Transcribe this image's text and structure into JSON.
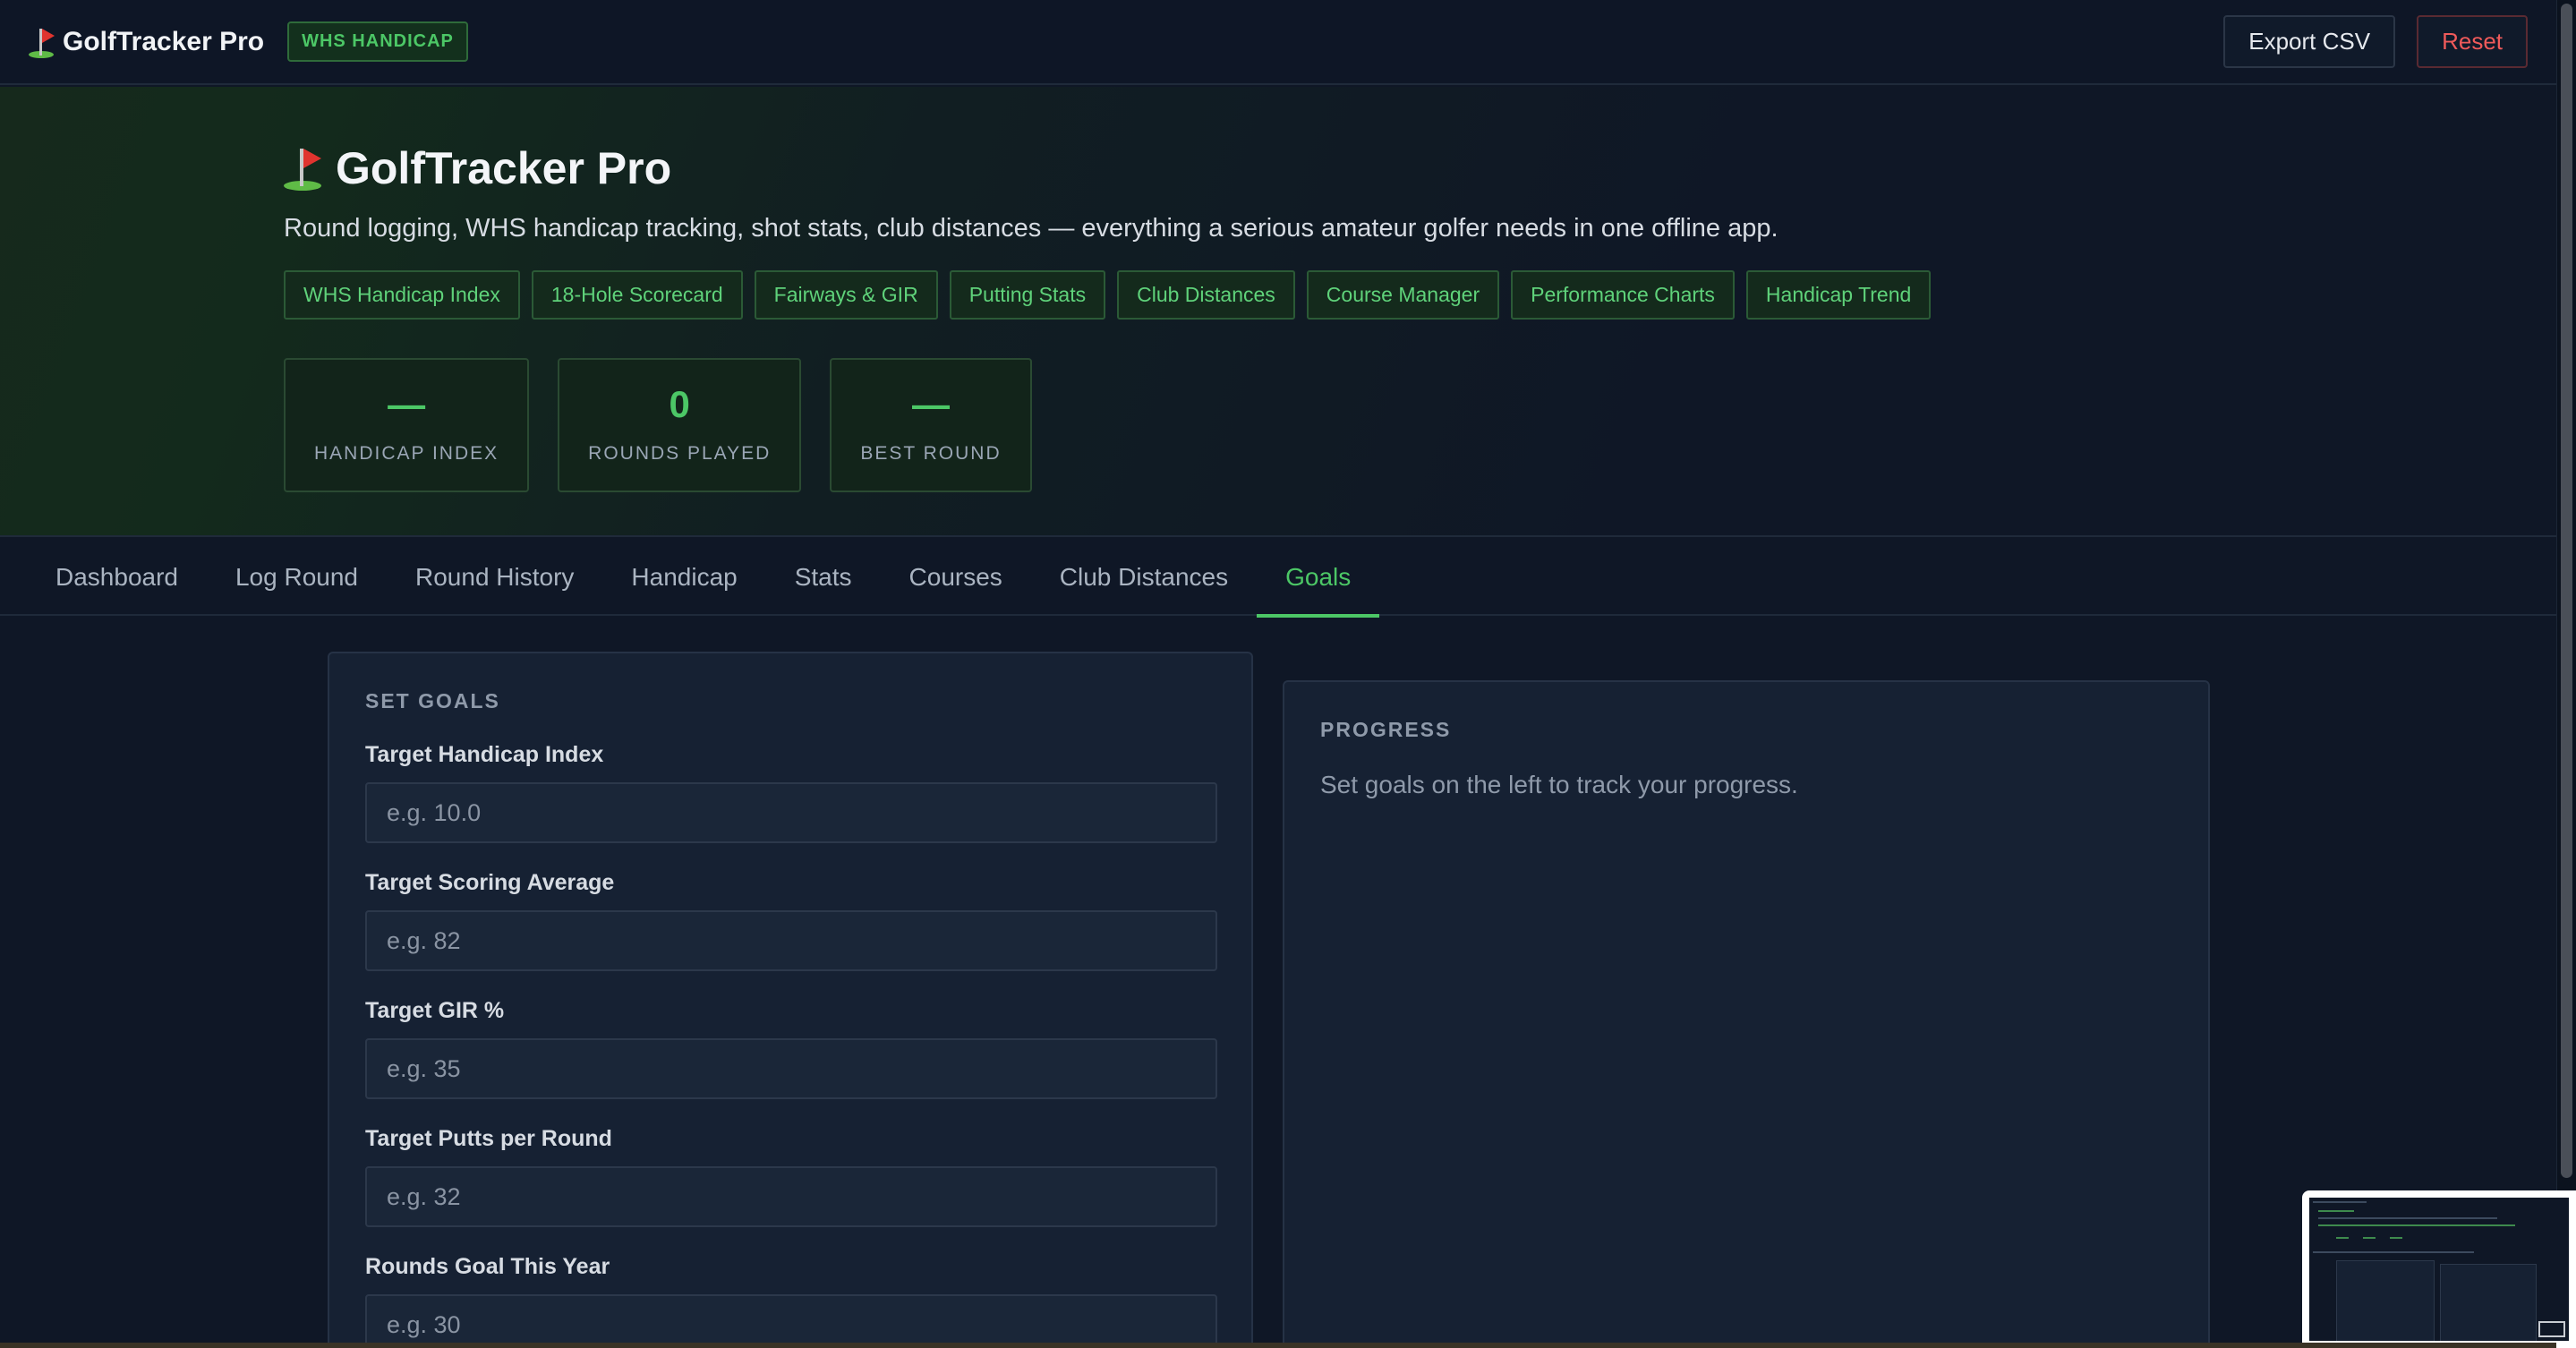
{
  "topbar": {
    "brand": "GolfTracker Pro",
    "badge": "WHS HANDICAP",
    "export_label": "Export CSV",
    "reset_label": "Reset"
  },
  "hero": {
    "title": "GolfTracker Pro",
    "subtitle": "Round logging, WHS handicap tracking, shot stats, club distances — everything a serious amateur golfer needs in one offline app.",
    "chips": [
      "WHS Handicap Index",
      "18-Hole Scorecard",
      "Fairways & GIR",
      "Putting Stats",
      "Club Distances",
      "Course Manager",
      "Performance Charts",
      "Handicap Trend"
    ],
    "stats": [
      {
        "value": "—",
        "label": "HANDICAP INDEX"
      },
      {
        "value": "0",
        "label": "ROUNDS PLAYED"
      },
      {
        "value": "—",
        "label": "BEST ROUND"
      }
    ]
  },
  "tabs": [
    "Dashboard",
    "Log Round",
    "Round History",
    "Handicap",
    "Stats",
    "Courses",
    "Club Distances",
    "Goals"
  ],
  "active_tab": "Goals",
  "goals": {
    "heading": "SET GOALS",
    "fields": [
      {
        "label": "Target Handicap Index",
        "placeholder": "e.g. 10.0",
        "value": ""
      },
      {
        "label": "Target Scoring Average",
        "placeholder": "e.g. 82",
        "value": ""
      },
      {
        "label": "Target GIR %",
        "placeholder": "e.g. 35",
        "value": ""
      },
      {
        "label": "Target Putts per Round",
        "placeholder": "e.g. 32",
        "value": ""
      },
      {
        "label": "Rounds Goal This Year",
        "placeholder": "e.g. 30",
        "value": ""
      }
    ]
  },
  "progress": {
    "heading": "PROGRESS",
    "message": "Set goals on the left to track your progress."
  },
  "colors": {
    "accent": "#4cc766",
    "background": "#0f1726",
    "panel": "#162133",
    "danger": "#ef5a5a"
  }
}
